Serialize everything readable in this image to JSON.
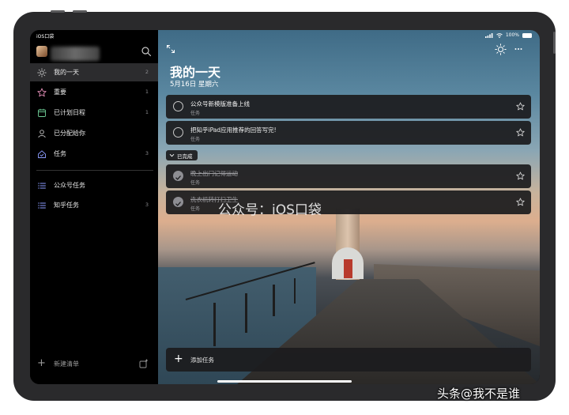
{
  "status": {
    "carrier": "iOS口袋",
    "battery": "100%"
  },
  "sidebar": {
    "items": [
      {
        "label": "我的一天",
        "count": "2",
        "icon": "sun-icon",
        "color": "#c8c8c8"
      },
      {
        "label": "重要",
        "count": "1",
        "icon": "star-icon",
        "color": "#e48fb8"
      },
      {
        "label": "已计划日程",
        "count": "1",
        "icon": "calendar-icon",
        "color": "#6fcf97"
      },
      {
        "label": "已分配给你",
        "count": "",
        "icon": "person-icon",
        "color": "#c8c8c8"
      },
      {
        "label": "任务",
        "count": "3",
        "icon": "home-icon",
        "color": "#8c9cff"
      }
    ],
    "lists": [
      {
        "label": "公众号任务",
        "count": "",
        "icon": "list-icon"
      },
      {
        "label": "知乎任务",
        "count": "3",
        "icon": "list-icon"
      }
    ],
    "new_list_label": "新建清单"
  },
  "main": {
    "title": "我的一天",
    "date": "5月16日 星期六",
    "tasks": [
      {
        "title": "公众号新模版准备上线",
        "sub": "任务",
        "done": false
      },
      {
        "title": "把知乎iPad应用推荐的回答写完!",
        "sub": "任务",
        "done": false
      }
    ],
    "completed_label": "已完成",
    "completed_tasks": [
      {
        "title": "晚上出门记得运动",
        "sub": "任务",
        "done": true
      },
      {
        "title": "洗衣机转打扫卫生",
        "sub": "任务",
        "done": true
      }
    ],
    "add_task_label": "添加任务",
    "watermark": "公众号：iOS口袋"
  },
  "footer_watermark": "头条@我不是谁"
}
